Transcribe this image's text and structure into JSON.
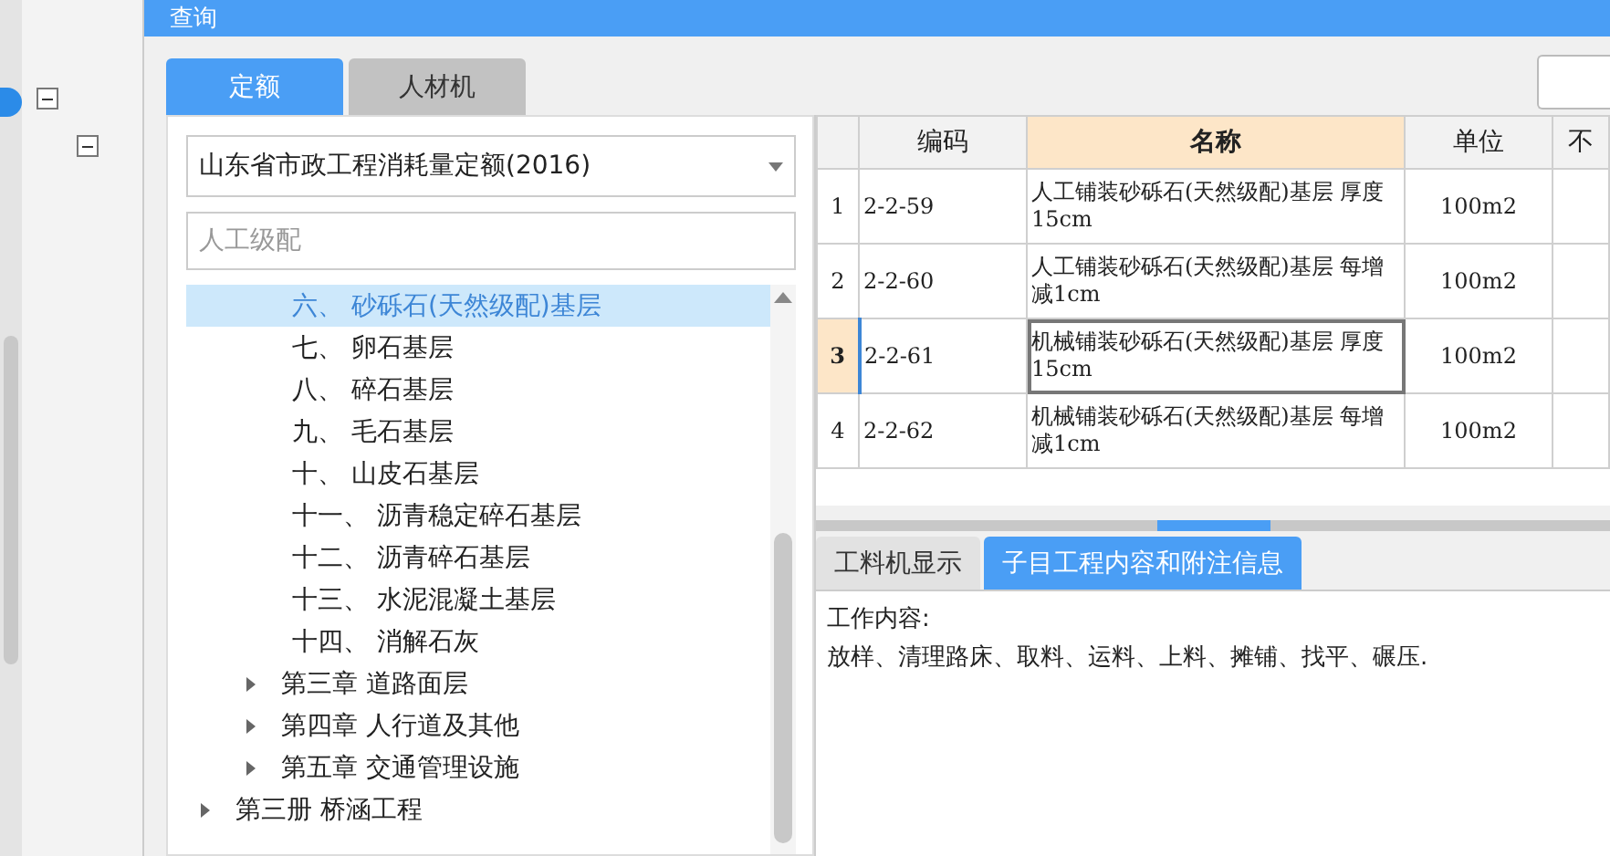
{
  "dialog": {
    "title": "查询"
  },
  "tabs": [
    {
      "label": "定额",
      "selected": true
    },
    {
      "label": "人材机",
      "selected": false
    }
  ],
  "library": {
    "value": "山东省市政工程消耗量定额(2016)"
  },
  "search": {
    "placeholder": "人工级配"
  },
  "tree": [
    {
      "children": [
        {
          "children": [
            {
              "label": "六、 砂砾石(天然级配)基层",
              "selected": true
            },
            {
              "label": "七、 卵石基层",
              "selected": false
            },
            {
              "label": "八、 碎石基层",
              "selected": false
            },
            {
              "label": "九、 毛石基层",
              "selected": false
            },
            {
              "label": "十、 山皮石基层",
              "selected": false
            },
            {
              "label": "十一、 沥青稳定碎石基层",
              "selected": false
            },
            {
              "label": "十二、 沥青碎石基层",
              "selected": false
            },
            {
              "label": "十三、 水泥混凝土基层",
              "selected": false
            },
            {
              "label": "十四、 消解石灰",
              "selected": false
            }
          ]
        },
        {
          "label": "第三章 道路面层",
          "expanded": false,
          "selected": false
        },
        {
          "label": "第四章 人行道及其他",
          "expanded": false,
          "selected": false
        },
        {
          "label": "第五章 交通管理设施",
          "expanded": false,
          "selected": false
        }
      ]
    },
    {
      "label": "第三册 桥涵工程",
      "expanded": false,
      "selected": false
    }
  ],
  "table": {
    "columns": [
      {
        "label": "编码",
        "selected": false
      },
      {
        "label": "名称",
        "selected": true
      },
      {
        "label": "单位",
        "selected": false
      },
      {
        "label": "不",
        "selected": false
      }
    ],
    "rows": [
      {
        "index": "1",
        "code": "2-2-59",
        "name": "人工铺装砂砾石(天然级配)基层 厚度15cm",
        "unit": "100m2",
        "selected": false
      },
      {
        "index": "2",
        "code": "2-2-60",
        "name": "人工铺装砂砾石(天然级配)基层 每增减1cm",
        "unit": "100m2",
        "selected": false
      },
      {
        "index": "3",
        "code": "2-2-61",
        "name": "机械铺装砂砾石(天然级配)基层 厚度15cm",
        "unit": "100m2",
        "selected": true
      },
      {
        "index": "4",
        "code": "2-2-62",
        "name": "机械铺装砂砾石(天然级配)基层 每增减1cm",
        "unit": "100m2",
        "selected": false
      }
    ]
  },
  "detail_tabs": [
    {
      "label": "工料机显示",
      "selected": false
    },
    {
      "label": "子目工程内容和附注信息",
      "selected": true
    }
  ],
  "detail": {
    "heading": "工作内容:",
    "text": "放样、清理路床、取料、运料、上料、摊铺、找平、碾压."
  }
}
